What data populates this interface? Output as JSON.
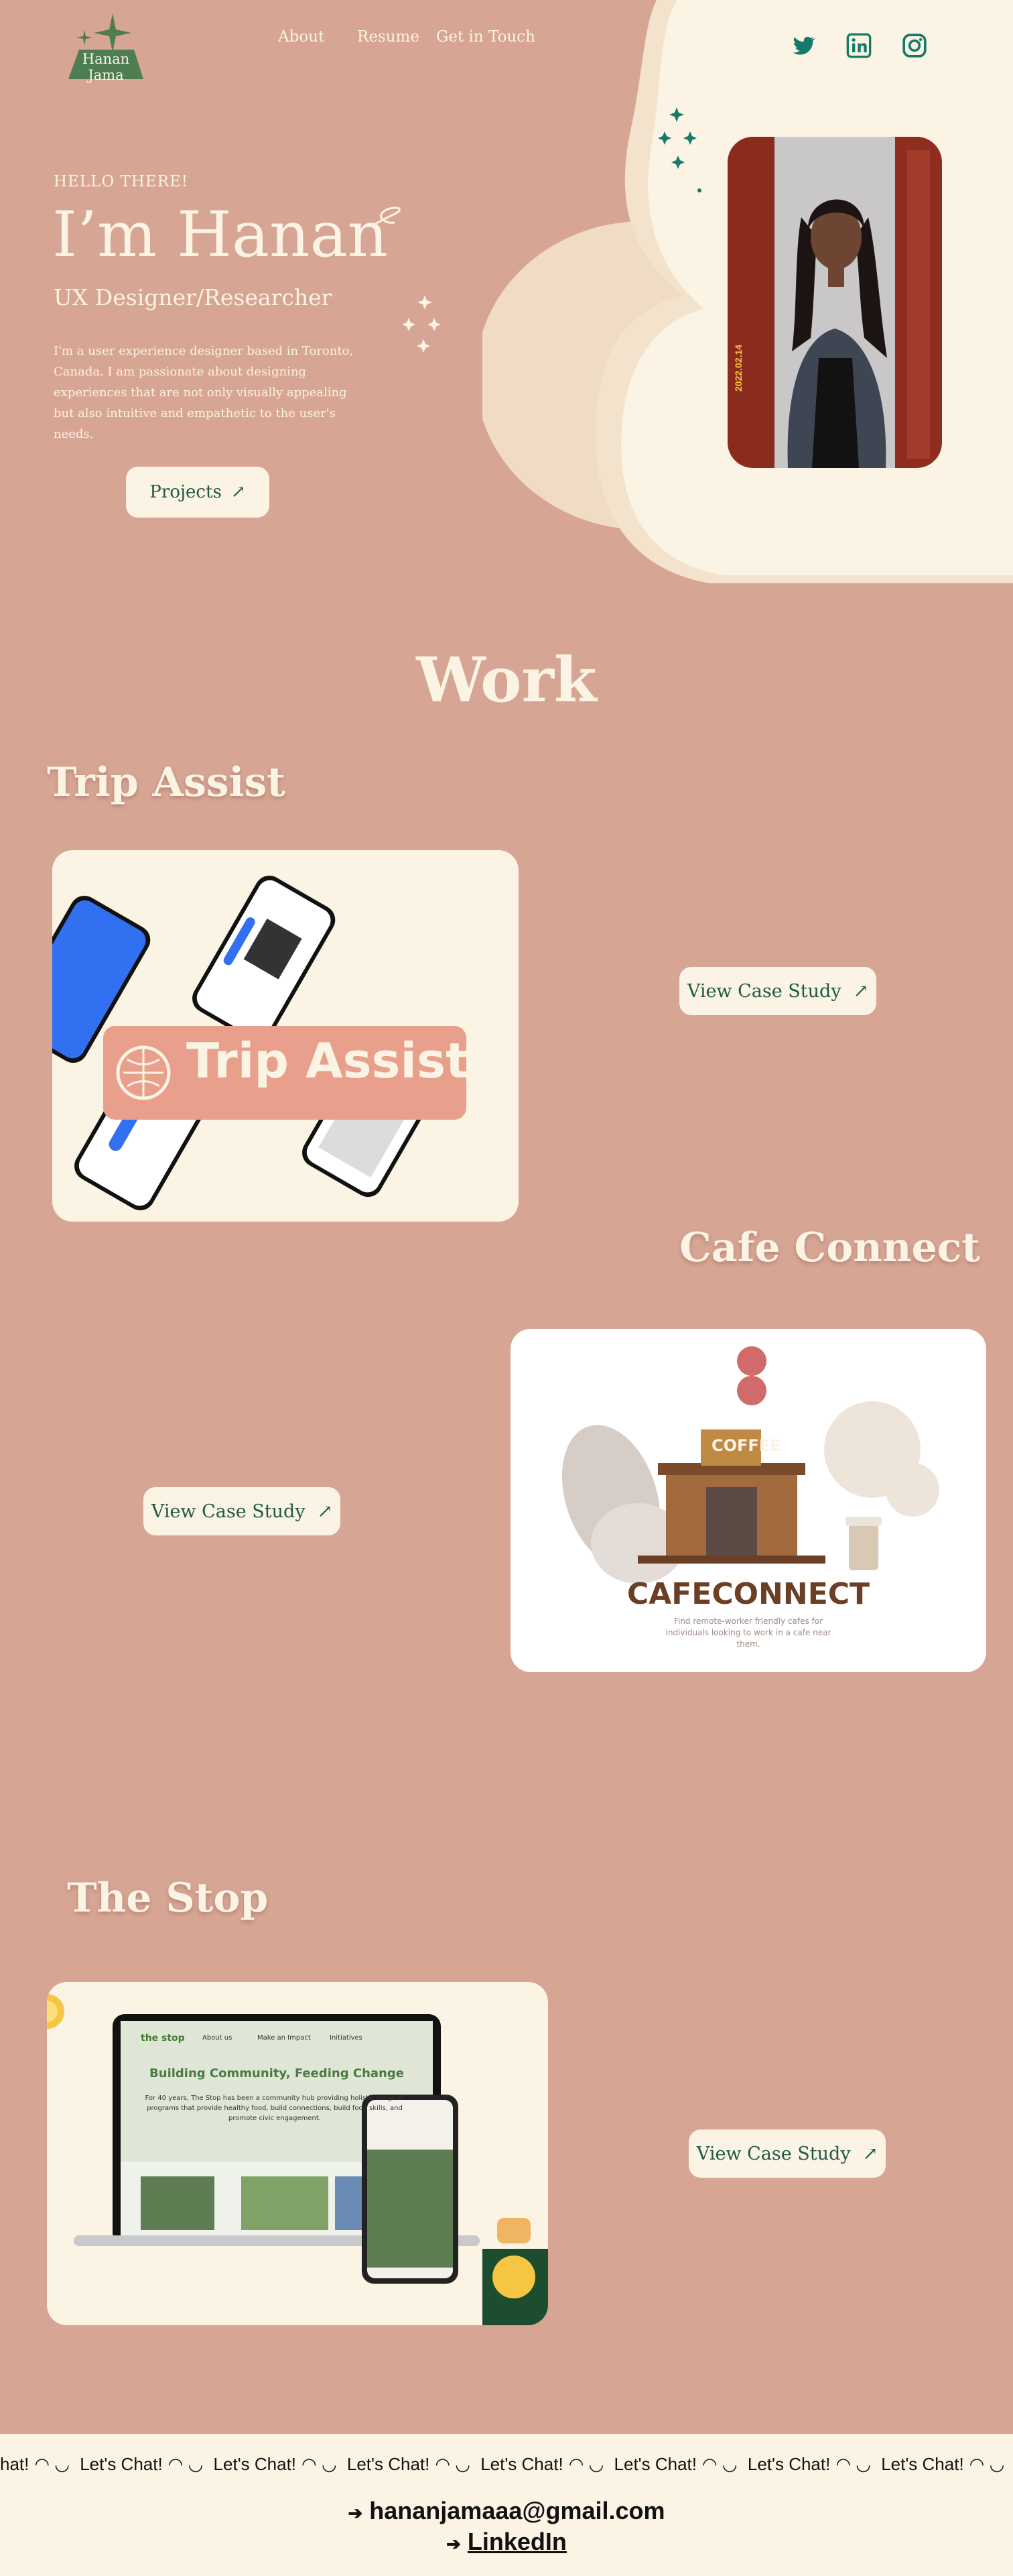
{
  "header": {
    "logo_text": "Hanan Jama",
    "nav": [
      "About",
      "Resume",
      "Get in Touch"
    ],
    "social": [
      "twitter-icon",
      "linkedin-icon",
      "instagram-icon"
    ]
  },
  "hero": {
    "greeting": "HELLO THERE!",
    "name": "I’m Hanan",
    "role": "UX Designer/Researcher",
    "intro": "I'm a user experience designer based in Toronto, Canada. I am passionate about designing experiences that are not only visually appealing but also intuitive and empathetic to the user's needs.",
    "projects_button": "Projects",
    "arrow": "↗",
    "photo_caption": "2022.02.14"
  },
  "work": {
    "title": "Work",
    "projects": [
      {
        "title": "Trip Assist",
        "banner": "Trip Assist",
        "button": "View Case Study"
      },
      {
        "title": "Cafe Connect",
        "sign": "COFFEE",
        "banner": "CAFECONNECT",
        "tagline": "Find remote-worker friendly cafes for individuals looking to work in a cafe near them.",
        "button": "View Case Study"
      },
      {
        "title": "The Stop",
        "site_logo": "the stop",
        "site_nav": [
          "About us",
          "Make an Impact",
          "Initiatives"
        ],
        "site_headline": "Building Community, Feeding Change",
        "site_body": "For 40 years, The Stop has been a community hub providing holistic range of programs that provide healthy food, build connections, build food skills, and promote civic engagement.",
        "button": "View Case Study"
      }
    ]
  },
  "footer": {
    "marquee_item": "Let's Chat!",
    "marquee_prefix": "hat!",
    "email": "hananjamaaa@gmail.com",
    "linkedin": "LinkedIn",
    "arrow": "➔"
  },
  "colors": {
    "background": "#d7a594",
    "cream": "#fbf3e3",
    "green": "#1e5a43",
    "teal": "#147a6a",
    "salmon": "#e8a08c"
  }
}
